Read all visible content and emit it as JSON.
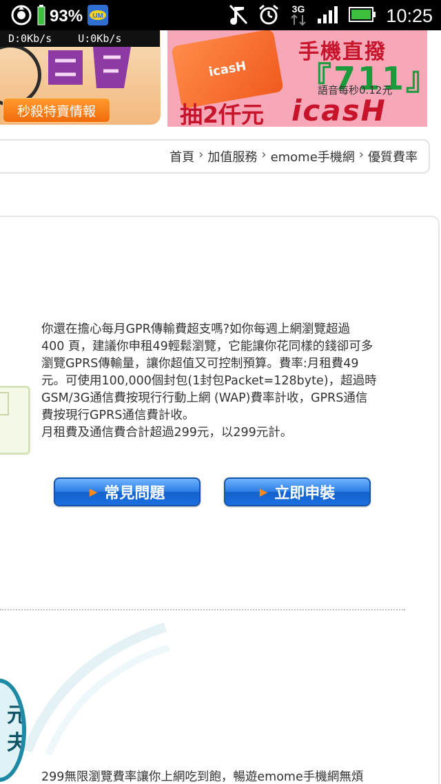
{
  "status_bar": {
    "battery_percent": "93%",
    "network_type": "3G",
    "time": "10:25"
  },
  "net_monitor": {
    "download": "D:0Kb/s",
    "upload": "U:0Kb/s"
  },
  "ads": {
    "left_banner": {
      "button_label": "秒殺特賣情報"
    },
    "right_banner": {
      "title": "手機直撥",
      "number": "『711』",
      "rate": "語音每秒0.12元",
      "prize": "抽2仟元",
      "brand": "icasH",
      "card_text": "icasH"
    }
  },
  "breadcrumb": {
    "items": [
      "首頁",
      "加值服務",
      "emome手機網",
      "優質費率"
    ],
    "separator": "›"
  },
  "main": {
    "description_lines": [
      "你還在擔心每月GPR傳輸費超支嗎?如你每週上網瀏覽超過",
      "400 頁，建議你申租49輕鬆瀏覽，它能讓你花同樣的錢卻可多",
      "瀏覽GPRS傳輸量，讓你超值又可控制預算。費率:月租費49",
      "元。可使用100,000個封包(1封包Packet=128byte)，超過時",
      "GSM/3G通信費按現行行動上網 (WAP)費率計收，GPRS通信",
      "費按現行GPRS通信費計收。",
      "月租費及通信費合計超過299元，以299元計。"
    ],
    "buttons": {
      "faq_label": "常見問題",
      "apply_label": "立即申裝"
    },
    "badge_text": [
      "元",
      "夫"
    ],
    "footer_text": "299無限瀏覽費率讓你上網吃到飽，暢遊emome手機網無煩"
  },
  "colors": {
    "button_blue": "#2d7fe6",
    "accent_orange": "#ff8a1c",
    "ad_red": "#c7142b",
    "ad_green": "#1a9b3c"
  }
}
